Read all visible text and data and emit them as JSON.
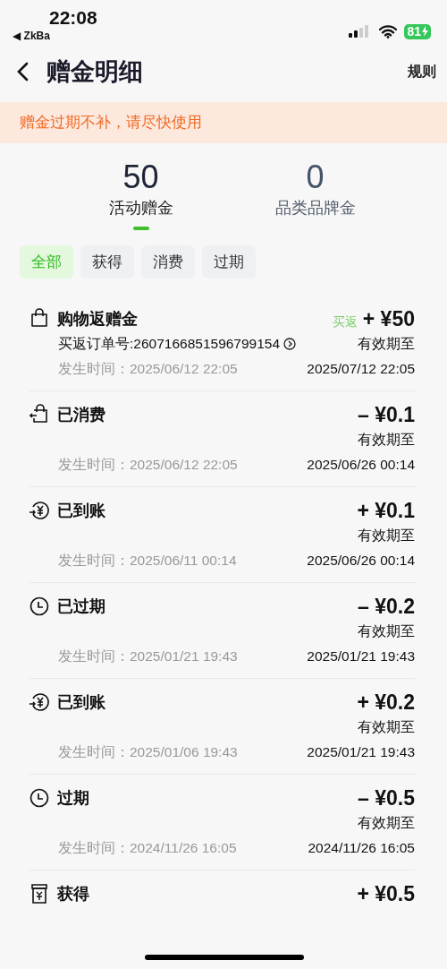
{
  "status_bar": {
    "time": "22:08",
    "back_app": "◀ ZkBa",
    "battery": "81"
  },
  "nav": {
    "title": "赠金明细",
    "action": "规则"
  },
  "notice": "赠金过期不补，请尽快使用",
  "summary_tabs": [
    {
      "value": "50",
      "label": "活动赠金",
      "selected": true
    },
    {
      "value": "0",
      "label": "品类品牌金",
      "selected": false
    }
  ],
  "filters": [
    {
      "label": "全部",
      "selected": true
    },
    {
      "label": "获得",
      "selected": false
    },
    {
      "label": "消费",
      "selected": false
    },
    {
      "label": "过期",
      "selected": false
    }
  ],
  "records": [
    {
      "kind": "bag",
      "title": "购物返赠金",
      "tag": "买返",
      "amount": "+ ¥50",
      "order": "买返订单号:2607166851596799154",
      "time_label": "发生时间：",
      "time": "2025/06/12 22:05",
      "expiry_label": "有效期至",
      "expiry": "2025/07/12 22:05"
    },
    {
      "kind": "refund",
      "title": "已消费",
      "amount": "– ¥0.1",
      "time_label": "发生时间：",
      "time": "2025/06/12 22:05",
      "expiry_label": "有效期至",
      "expiry": "2025/06/26 00:14"
    },
    {
      "kind": "income",
      "title": "已到账",
      "amount": "+ ¥0.1",
      "time_label": "发生时间：",
      "time": "2025/06/11 00:14",
      "expiry_label": "有效期至",
      "expiry": "2025/06/26 00:14"
    },
    {
      "kind": "clock",
      "title": "已过期",
      "amount": "– ¥0.2",
      "time_label": "发生时间：",
      "time": "2025/01/21 19:43",
      "expiry_label": "有效期至",
      "expiry": "2025/01/21 19:43"
    },
    {
      "kind": "income",
      "title": "已到账",
      "amount": "+ ¥0.2",
      "time_label": "发生时间：",
      "time": "2025/01/06 19:43",
      "expiry_label": "有效期至",
      "expiry": "2025/01/21 19:43"
    },
    {
      "kind": "clock",
      "title": "过期",
      "amount": "– ¥0.5",
      "time_label": "发生时间：",
      "time": "2024/11/26 16:05",
      "expiry_label": "有效期至",
      "expiry": "2024/11/26 16:05"
    },
    {
      "kind": "box",
      "title": "获得",
      "amount": "+ ¥0.5"
    }
  ]
}
